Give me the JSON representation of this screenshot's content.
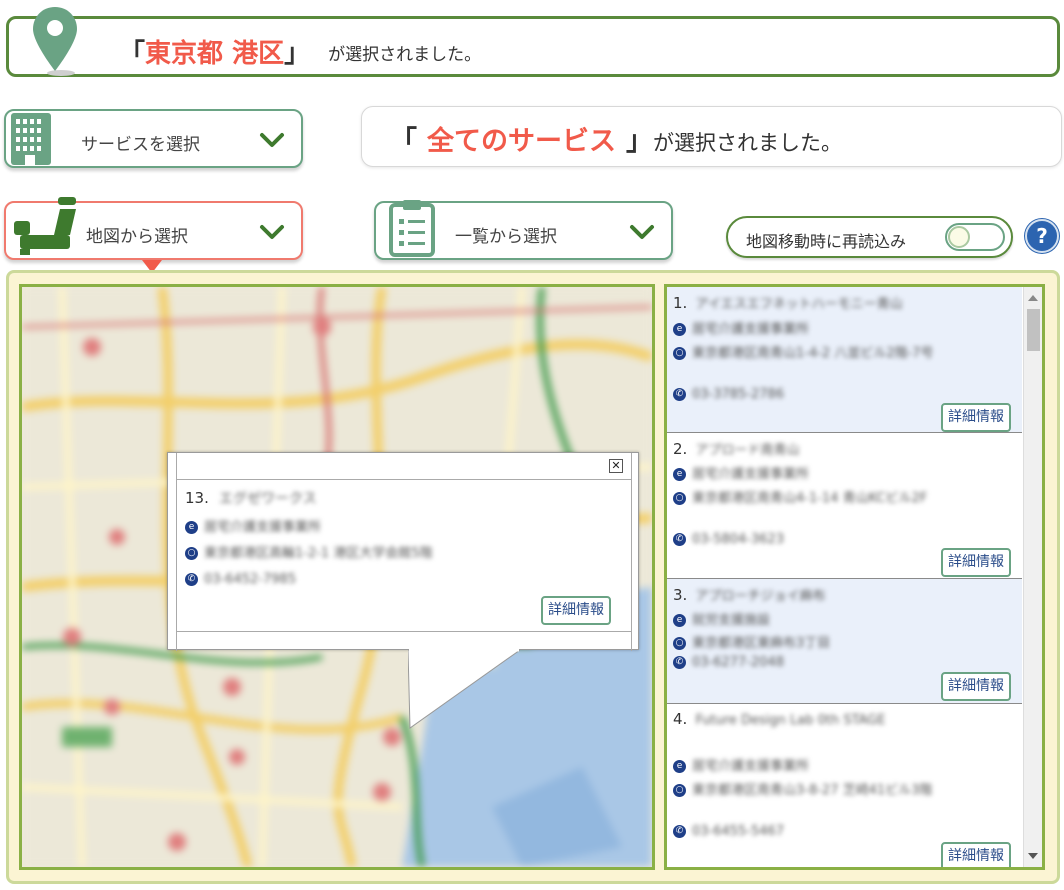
{
  "area": {
    "open_bracket": "「",
    "name": "東京都 港区",
    "close_bracket": "」",
    "suffix": "が選択されました。"
  },
  "service": {
    "select_label": "サービスを選択",
    "open_bracket": "「",
    "selected": "全てのサービス",
    "close_bracket": "」",
    "suffix": "が選択されました。"
  },
  "tabs": {
    "map_label": "地図から選択",
    "list_label": "一覧から選択"
  },
  "reload": {
    "label": "地図移動時に再読込み",
    "enabled": false
  },
  "help": {
    "label": "?"
  },
  "popup": {
    "number": "13.",
    "name": "エグゼワークス",
    "category": "居宅介護支援事業所",
    "address": "東京都港区高輪1-2-1 港区大学会館5階",
    "phone": "03-6452-7985",
    "detail_label": "詳細情報"
  },
  "list": [
    {
      "number": "1.",
      "name": "アイエスエフネットハーモニー青山",
      "category": "居宅介護支援事業所",
      "address": "東京都港区南青山1-4-2 八並ビル2階-7号",
      "phone": "03-3785-2786",
      "detail_label": "詳細情報"
    },
    {
      "number": "2.",
      "name": "アプロード南青山",
      "category": "居宅介護支援事業所",
      "address": "東京都港区南青山4-1-14 青山KCビル2F",
      "phone": "03-5804-3623",
      "detail_label": "詳細情報"
    },
    {
      "number": "3.",
      "name": "アプローチジョイ麻布",
      "category": "就労支援施設",
      "address": "東京都港区東麻布3丁目",
      "phone": "03-6277-2048",
      "detail_label": "詳細情報"
    },
    {
      "number": "4.",
      "name": "Future Design Lab 0th STAGE",
      "category": "居宅介護支援事業所",
      "address": "東京都港区南青山3-8-27 芝崎41ビル3階",
      "phone": "03-6455-5467",
      "detail_label": "詳細情報"
    }
  ],
  "colors": {
    "accent_red": "#f15a4a",
    "border_green": "#5a8a3c",
    "button_green": "#6aa384",
    "panel_bg": "#fbf4d3",
    "list_odd_bg": "#eaf0fa"
  }
}
